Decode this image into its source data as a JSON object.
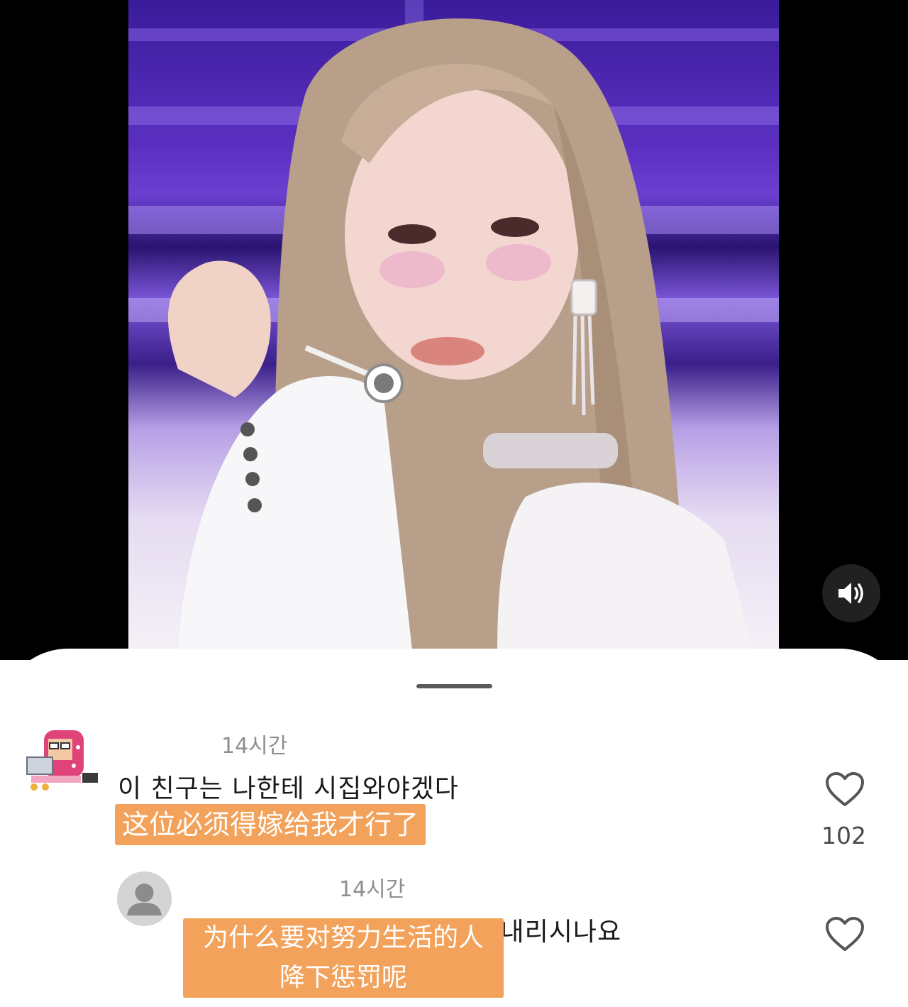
{
  "video": {
    "description_icon": "performer-video-frame"
  },
  "controls": {
    "sound_icon": "speaker-volume-icon"
  },
  "comments": [
    {
      "time": "14시간",
      "text": "이 친구는 나한테 시집와야겠다",
      "translation": "这位必须得嫁给我才行了",
      "likes": "102",
      "avatar_icon": "pixel-character-avatar"
    },
    {
      "time": "14시간",
      "text": "열심히 사시는 분께 왜 벌을 내리시나요",
      "translation_line1": "为什么要对努力生活的人",
      "translation_line2": "降下惩罚呢",
      "avatar_icon": "default-user-avatar"
    }
  ],
  "colors": {
    "translation_highlight": "#f2a25a",
    "timestamp": "#8e8e8e"
  }
}
